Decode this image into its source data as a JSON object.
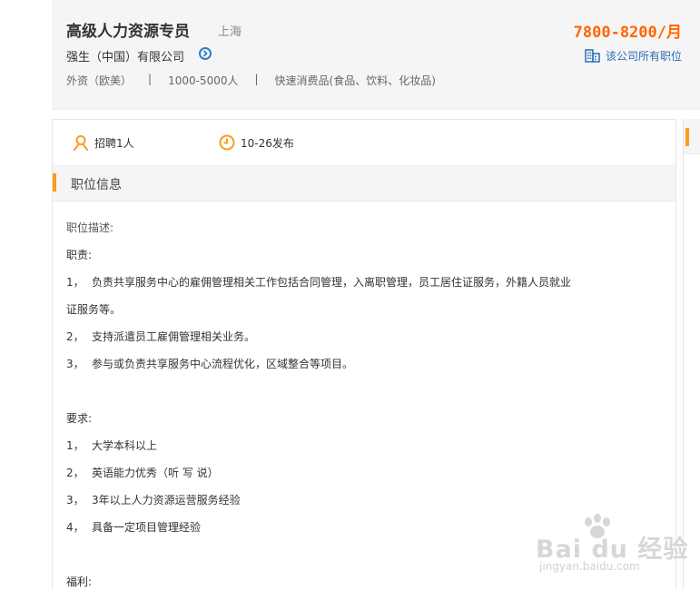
{
  "job": {
    "title": "高级人力资源专员",
    "location": "上海",
    "salary": "7800-8200/月",
    "company": "强生（中国）有限公司",
    "all_jobs_link": "该公司所有职位",
    "meta": [
      "外资（欧美）",
      "1000-5000人",
      "快速消费品(食品、饮料、化妆品)"
    ],
    "meta_separator": "|"
  },
  "stats": {
    "headcount": "招聘1人",
    "posted": "10-26发布"
  },
  "section": {
    "title": "职位信息"
  },
  "description": {
    "heading": "职位描述:",
    "duties_heading": "职责:",
    "duties": [
      {
        "num": "1，",
        "text": "负责共享服务中心的雇佣管理相关工作包括合同管理，入离职管理，员工居住证服务，外籍人员就业"
      },
      {
        "num": "",
        "text": "证服务等。"
      },
      {
        "num": "2，",
        "text": "支持派遣员工雇佣管理相关业务。"
      },
      {
        "num": "3，",
        "text": "参与或负责共享服务中心流程优化，区域整合等项目。"
      }
    ],
    "requirements_heading": "要求:",
    "requirements": [
      {
        "num": "1，",
        "text": "大学本科以上"
      },
      {
        "num": "2，",
        "text": "英语能力优秀（听 写 说）"
      },
      {
        "num": "3，",
        "text": "3年以上人力资源运营服务经验"
      },
      {
        "num": "4，",
        "text": "具备一定项目管理经验"
      }
    ],
    "benefits_heading": "福利:"
  },
  "watermark": {
    "main": "Bai du 经验",
    "sub": "jingyan.baidu.com"
  },
  "colors": {
    "accent_orange": "#ff9a1d",
    "salary_orange": "#ff6600",
    "link_blue": "#2d6db8"
  },
  "icons": {
    "company_arrow": "chevron-right-circle-icon",
    "all_jobs": "building-icon",
    "headcount": "person-icon",
    "posted": "clock-icon"
  }
}
